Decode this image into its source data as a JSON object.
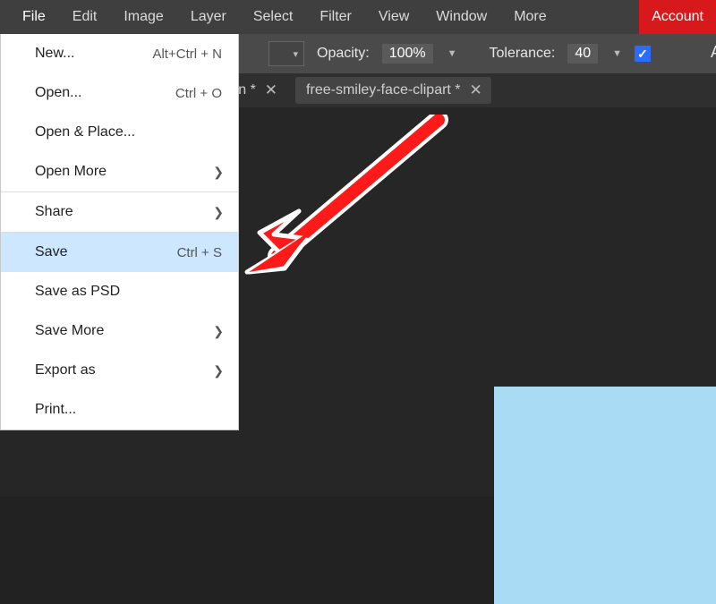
{
  "menubar": {
    "items": [
      "File",
      "Edit",
      "Image",
      "Layer",
      "Select",
      "Filter",
      "View",
      "Window",
      "More"
    ],
    "account": "Account"
  },
  "options": {
    "opacity_label": "Opacity:",
    "opacity_value": "100%",
    "tolerance_label": "Tolerance:",
    "tolerance_value": "40",
    "checkbox_checked": true,
    "trailing_cut": "A"
  },
  "tabs": {
    "tab1_fragment": "-pn *",
    "tab2_label": "free-smiley-face-clipart *"
  },
  "file_menu": {
    "items": [
      {
        "label": "New...",
        "shortcut": "Alt+Ctrl + N",
        "submenu": false,
        "highlight": false
      },
      {
        "label": "Open...",
        "shortcut": "Ctrl + O",
        "submenu": false,
        "highlight": false
      },
      {
        "label": "Open & Place...",
        "shortcut": "",
        "submenu": false,
        "highlight": false
      },
      {
        "label": "Open More",
        "shortcut": "",
        "submenu": true,
        "highlight": false
      },
      {
        "sep": true
      },
      {
        "label": "Share",
        "shortcut": "",
        "submenu": true,
        "highlight": false
      },
      {
        "sep": true
      },
      {
        "label": "Save",
        "shortcut": "Ctrl + S",
        "submenu": false,
        "highlight": true
      },
      {
        "label": "Save as PSD",
        "shortcut": "",
        "submenu": false,
        "highlight": false
      },
      {
        "label": "Save More",
        "shortcut": "",
        "submenu": true,
        "highlight": false
      },
      {
        "label": "Export as",
        "shortcut": "",
        "submenu": true,
        "highlight": false
      },
      {
        "label": "Print...",
        "shortcut": "",
        "submenu": false,
        "highlight": false
      }
    ]
  }
}
